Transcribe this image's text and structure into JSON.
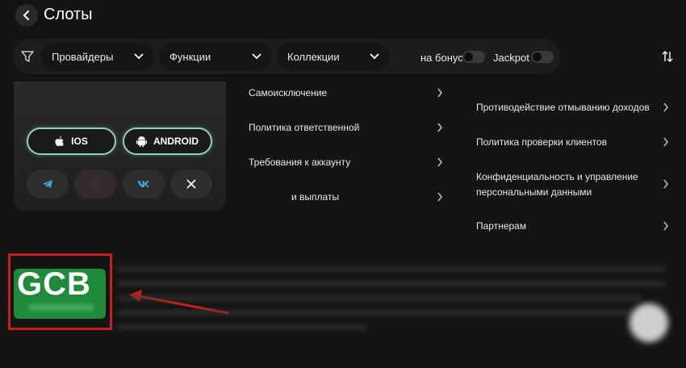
{
  "header": {
    "title": "Слоты"
  },
  "filters": {
    "providers_label": "Провайдеры",
    "functions_label": "Функции",
    "collections_label": "Коллекции",
    "bonus_label": "на бонус",
    "jackpot_label": "Jackpot"
  },
  "apps": {
    "ios_label": "IOS",
    "android_label": "ANDROID"
  },
  "links_left": [
    "Самоисключение",
    "Политика ответственной",
    "Требования к аккаунту",
    "и выплаты"
  ],
  "links_right": [
    "Противодействие отмыванию доходов",
    "Политика проверки клиентов",
    "Конфиденциальность и управление",
    "персональными данными",
    "Партнерам"
  ],
  "logo": {
    "text": "GCB"
  },
  "colors": {
    "background": "#141414",
    "accent_green": "#1f8a3a",
    "highlight_red": "#c8201c"
  }
}
